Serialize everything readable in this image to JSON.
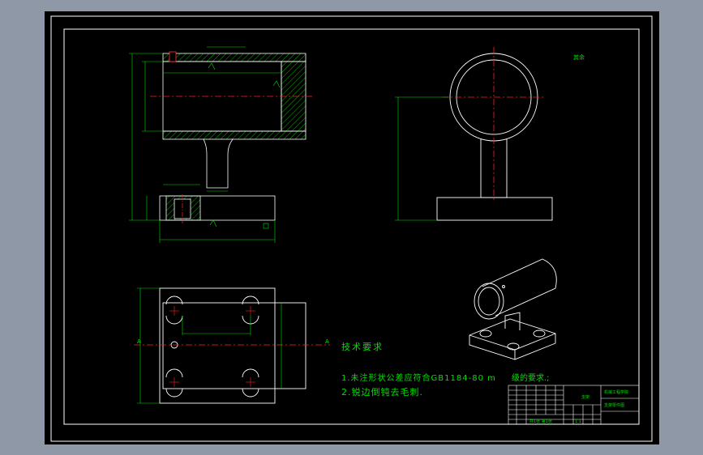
{
  "drawing": {
    "roughness_mark": "其余",
    "tech_req_title": "技术要求",
    "tech_req_line1": "1.未注形状公差应符合GB1184-80 m",
    "tech_req_line1_tail": "级的要求.;",
    "tech_req_line2": "2.锐边倒钝去毛刺.",
    "section_label_left": "A",
    "section_label_right": "A"
  },
  "title_block": {
    "name_cell": "支架",
    "company_cell": "机械工程学院",
    "drawing_no_cell": "支架零件图",
    "scale_cell": "1:1",
    "sheet_cell": "共1张 第1张"
  },
  "colors": {
    "line": "#ffffff",
    "dim": "#00e000",
    "center": "#ff2020",
    "hatch": "#00e000",
    "background": "#000000",
    "outer_bg": "#8f98a7"
  }
}
